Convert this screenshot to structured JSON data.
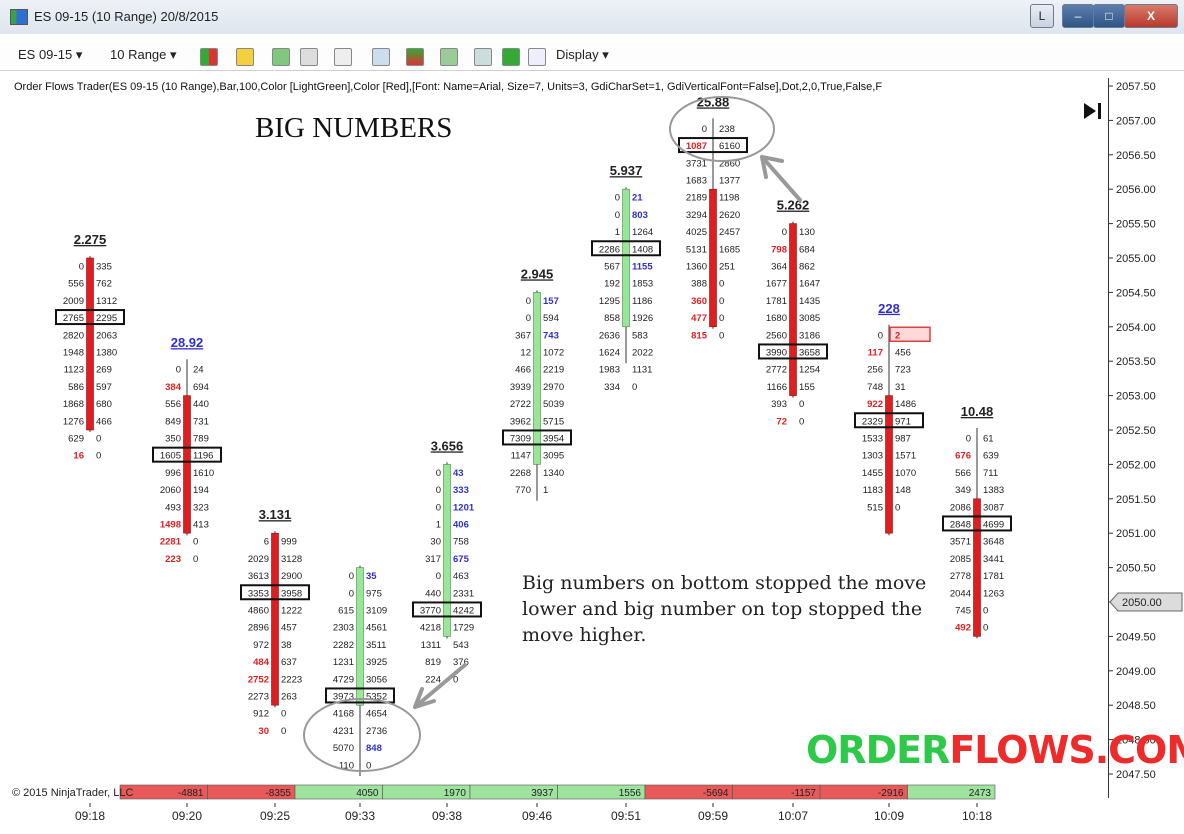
{
  "window": {
    "title": "ES 09-15 (10 Range)  20/8/2015",
    "btn_l": "L",
    "btn_min": "–",
    "btn_max": "□",
    "btn_close": "X"
  },
  "toolbar": {
    "instrument": "ES 09-15 ▾",
    "period": "10 Range ▾",
    "display": "Display ▾"
  },
  "indicator_label": "Order Flows Trader(ES 09-15 (10 Range),Bar,100,Color [LightGreen],Color [Red],[Font: Name=Arial, Size=7, Units=3, GdiCharSet=1, GdiVerticalFont=False],Dot,2,0,True,False,F",
  "annotations": {
    "big_numbers_title": "BIG NUMBERS",
    "note": "Big numbers on bottom stopped the move lower and big number on top stopped the move higher.",
    "brand_part1": "ORDER",
    "brand_part2": "FLOWS.COM",
    "copyright": "© 2015 NinjaTrader, LLC"
  },
  "colors": {
    "up": "#99e699",
    "down": "#dd1f1f",
    "bid_red": "#e02020",
    "ask_blue": "#2f2fcf",
    "box": "#111111",
    "delta_neg": "#e85a5a",
    "delta_pos": "#9ee39e"
  },
  "chart_data": {
    "type": "footprint",
    "y_axis": {
      "min": 2047.5,
      "max": 2057.5,
      "step": 0.5,
      "current_price": "2050.00"
    },
    "x_ticks": [
      "09:18",
      "09:20",
      "09:25",
      "09:33",
      "09:38",
      "09:46",
      "09:51",
      "09:59",
      "10:07",
      "10:09",
      "10:18"
    ],
    "bars": [
      {
        "time": "09:18",
        "direction": "down",
        "open": 2055.0,
        "close": 2052.5,
        "high": 2055.0,
        "low": 2052.5,
        "label": "2.275",
        "levels": [
          [
            0,
            335
          ],
          [
            556,
            762
          ],
          [
            2009,
            1312
          ],
          [
            2765,
            2295
          ],
          [
            2820,
            2063
          ],
          [
            1948,
            1380
          ],
          [
            1123,
            269
          ],
          [
            586,
            597
          ],
          [
            1868,
            680
          ],
          [
            1276,
            466
          ],
          [
            629,
            0
          ],
          [
            16,
            0
          ]
        ],
        "red_bids": [
          11
        ],
        "blue_asks": [],
        "boxed": 3
      },
      {
        "time": "09:20",
        "direction": "down",
        "open": 2053.0,
        "close": 2051.0,
        "high": 2053.5,
        "low": 2051.0,
        "label": "28.92",
        "levels": [
          [
            0,
            24
          ],
          [
            384,
            694
          ],
          [
            556,
            440
          ],
          [
            849,
            731
          ],
          [
            350,
            789
          ],
          [
            1605,
            1196
          ],
          [
            996,
            1610
          ],
          [
            2060,
            194
          ],
          [
            493,
            323
          ],
          [
            1498,
            413
          ],
          [
            2281,
            0
          ],
          [
            223,
            0
          ]
        ],
        "red_bids": [
          1,
          9,
          10,
          11
        ],
        "blue_asks": [],
        "boxed": 5
      },
      {
        "time": "09:25",
        "direction": "down",
        "open": 2051.0,
        "close": 2048.5,
        "high": 2051.0,
        "low": 2048.5,
        "label": "3.131",
        "levels": [
          [
            6,
            999
          ],
          [
            2029,
            3128
          ],
          [
            3613,
            2900
          ],
          [
            3353,
            3958
          ],
          [
            4860,
            1222
          ],
          [
            2896,
            457
          ],
          [
            972,
            38
          ],
          [
            484,
            637
          ],
          [
            2752,
            2223
          ],
          [
            2273,
            263
          ],
          [
            912,
            0
          ],
          [
            30,
            0
          ]
        ],
        "red_bids": [
          7,
          8,
          11
        ],
        "blue_asks": [],
        "boxed": 3
      },
      {
        "time": "09:33",
        "direction": "up",
        "open": 2048.5,
        "close": 2050.5,
        "high": 2050.5,
        "low": 2047.5,
        "label": "",
        "levels": [
          [
            0,
            35
          ],
          [
            0,
            975
          ],
          [
            615,
            3109
          ],
          [
            2303,
            4561
          ],
          [
            2282,
            3511
          ],
          [
            1231,
            3925
          ],
          [
            4729,
            3056
          ],
          [
            3973,
            5352
          ],
          [
            4168,
            4654
          ],
          [
            4231,
            2736
          ],
          [
            5070,
            848
          ],
          [
            110,
            0
          ]
        ],
        "red_bids": [],
        "blue_asks": [
          0,
          10
        ],
        "boxed": 7
      },
      {
        "time": "09:38",
        "direction": "up",
        "open": 2049.5,
        "close": 2052.0,
        "high": 2052.0,
        "low": 2049.5,
        "label": "3.656",
        "levels": [
          [
            0,
            43
          ],
          [
            0,
            333
          ],
          [
            0,
            1201
          ],
          [
            1,
            406
          ],
          [
            30,
            758
          ],
          [
            317,
            675
          ],
          [
            0,
            463
          ],
          [
            440,
            2331
          ],
          [
            3770,
            4242
          ],
          [
            4218,
            1729
          ],
          [
            1311,
            543
          ],
          [
            819,
            376
          ],
          [
            224,
            0
          ]
        ],
        "red_bids": [],
        "blue_asks": [
          0,
          1,
          2,
          3,
          5
        ],
        "boxed": 8
      },
      {
        "time": "09:46",
        "direction": "up",
        "open": 2052.0,
        "close": 2054.5,
        "high": 2054.5,
        "low": 2051.5,
        "label": "2.945",
        "levels": [
          [
            0,
            157
          ],
          [
            0,
            594
          ],
          [
            367,
            743
          ],
          [
            12,
            1072
          ],
          [
            466,
            2219
          ],
          [
            3939,
            2970
          ],
          [
            2722,
            5039
          ],
          [
            3962,
            5715
          ],
          [
            7309,
            3954
          ],
          [
            1147,
            3095
          ],
          [
            2268,
            1340
          ],
          [
            770,
            1
          ]
        ],
        "red_bids": [],
        "blue_asks": [
          0,
          2
        ],
        "boxed": 8
      },
      {
        "time": "09:51",
        "direction": "up",
        "open": 2054.0,
        "close": 2056.0,
        "high": 2056.0,
        "low": 2053.5,
        "label": "5.937",
        "levels": [
          [
            0,
            21
          ],
          [
            0,
            803
          ],
          [
            1,
            1264
          ],
          [
            2286,
            1408
          ],
          [
            567,
            1155
          ],
          [
            192,
            1853
          ],
          [
            1295,
            1186
          ],
          [
            858,
            1926
          ],
          [
            2636,
            583
          ],
          [
            1624,
            2022
          ],
          [
            1983,
            1131
          ],
          [
            334,
            0
          ]
        ],
        "red_bids": [],
        "blue_asks": [
          0,
          1,
          4
        ],
        "boxed": 3
      },
      {
        "time": "09:59",
        "direction": "down",
        "open": 2056.0,
        "close": 2054.0,
        "high": 2057.0,
        "low": 2054.0,
        "label": "25.88",
        "levels": [
          [
            0,
            238
          ],
          [
            1087,
            6160
          ],
          [
            3731,
            2860
          ],
          [
            1683,
            1377
          ],
          [
            2189,
            1198
          ],
          [
            3294,
            2620
          ],
          [
            4025,
            2457
          ],
          [
            5131,
            1685
          ],
          [
            1360,
            251
          ],
          [
            388,
            0
          ],
          [
            360,
            0
          ],
          [
            477,
            0
          ],
          [
            815,
            0
          ]
        ],
        "red_bids": [
          1,
          10,
          11,
          12
        ],
        "blue_asks": [],
        "boxed": 1
      },
      {
        "time": "10:07",
        "direction": "down",
        "open": 2055.5,
        "close": 2053.0,
        "high": 2055.5,
        "low": 2053.0,
        "label": "5.262",
        "levels": [
          [
            0,
            130
          ],
          [
            798,
            684
          ],
          [
            364,
            862
          ],
          [
            1677,
            1647
          ],
          [
            1781,
            1435
          ],
          [
            1680,
            3085
          ],
          [
            2560,
            3186
          ],
          [
            3990,
            3658
          ],
          [
            2772,
            1254
          ],
          [
            1166,
            155
          ],
          [
            393,
            0
          ],
          [
            72,
            0
          ]
        ],
        "red_bids": [
          1,
          11
        ],
        "blue_asks": [],
        "boxed": 7
      },
      {
        "time": "10:09",
        "direction": "down",
        "open": 2053.0,
        "close": 2051.0,
        "high": 2054.0,
        "low": 2051.0,
        "label": "228",
        "levels": [
          [
            0,
            2
          ],
          [
            117,
            456
          ],
          [
            256,
            723
          ],
          [
            748,
            31
          ],
          [
            922,
            1486
          ],
          [
            2329,
            971
          ],
          [
            1533,
            987
          ],
          [
            1303,
            1571
          ],
          [
            1455,
            1070
          ],
          [
            1183,
            148
          ],
          [
            515,
            0
          ]
        ],
        "red_bids": [
          1,
          4
        ],
        "blue_asks": [],
        "boxed": 5,
        "highlight": 0
      },
      {
        "time": "10:18",
        "direction": "down",
        "open": 2051.5,
        "close": 2049.5,
        "high": 2052.5,
        "low": 2049.5,
        "label": "10.48",
        "levels": [
          [
            0,
            61
          ],
          [
            676,
            639
          ],
          [
            566,
            711
          ],
          [
            349,
            1383
          ],
          [
            2086,
            3087
          ],
          [
            2848,
            4699
          ],
          [
            3571,
            3648
          ],
          [
            2085,
            3441
          ],
          [
            2778,
            1781
          ],
          [
            2044,
            1263
          ],
          [
            745,
            0
          ],
          [
            492,
            0
          ]
        ],
        "red_bids": [
          1,
          11
        ],
        "blue_asks": [],
        "boxed": 5
      }
    ],
    "delta_strip": [
      "-4881",
      "-8355",
      "4050",
      "1970",
      "3937",
      "1556",
      "-5694",
      "-1157",
      "-2916",
      "2473"
    ]
  }
}
